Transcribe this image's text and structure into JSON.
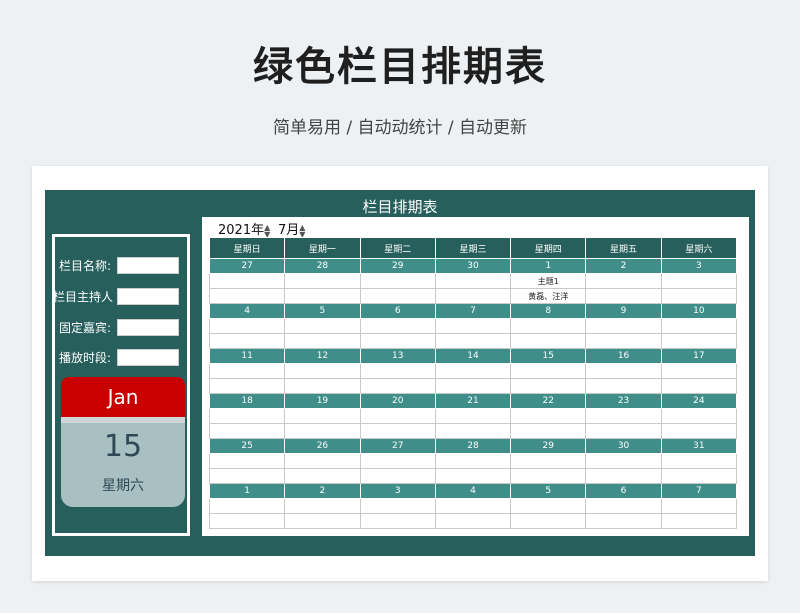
{
  "page": {
    "title": "绿色栏目排期表",
    "subtitle": "简单易用 / 自动动统计 / 自动更新"
  },
  "sheet": {
    "title": "栏目排期表",
    "year_value": "2021年",
    "month_value": "7月",
    "fields": [
      {
        "label": "栏目名称:",
        "value": ""
      },
      {
        "label": "栏目主持人",
        "value": ""
      },
      {
        "label": "固定嘉宾:",
        "value": ""
      },
      {
        "label": "播放时段:",
        "value": ""
      }
    ],
    "calendar_card": {
      "month": "Jan",
      "day": "15",
      "weekday": "星期六"
    },
    "weekdays": [
      "星期日",
      "星期一",
      "星期二",
      "星期三",
      "星期四",
      "星期五",
      "星期六"
    ],
    "weeks": [
      {
        "dates": [
          "27",
          "28",
          "29",
          "30",
          "1",
          "2",
          "3"
        ],
        "events1": [
          "",
          "",
          "",
          "",
          "主题1",
          "",
          ""
        ],
        "events2": [
          "",
          "",
          "",
          "",
          "黄磊、汪洋",
          "",
          ""
        ]
      },
      {
        "dates": [
          "4",
          "5",
          "6",
          "7",
          "8",
          "9",
          "10"
        ],
        "events1": [
          "",
          "",
          "",
          "",
          "",
          "",
          ""
        ],
        "events2": [
          "",
          "",
          "",
          "",
          "",
          "",
          ""
        ]
      },
      {
        "dates": [
          "11",
          "12",
          "13",
          "14",
          "15",
          "16",
          "17"
        ],
        "events1": [
          "",
          "",
          "",
          "",
          "",
          "",
          ""
        ],
        "events2": [
          "",
          "",
          "",
          "",
          "",
          "",
          ""
        ]
      },
      {
        "dates": [
          "18",
          "19",
          "20",
          "21",
          "22",
          "23",
          "24"
        ],
        "events1": [
          "",
          "",
          "",
          "",
          "",
          "",
          ""
        ],
        "events2": [
          "",
          "",
          "",
          "",
          "",
          "",
          ""
        ]
      },
      {
        "dates": [
          "25",
          "26",
          "27",
          "28",
          "29",
          "30",
          "31"
        ],
        "events1": [
          "",
          "",
          "",
          "",
          "",
          "",
          ""
        ],
        "events2": [
          "",
          "",
          "",
          "",
          "",
          "",
          ""
        ]
      },
      {
        "dates": [
          "1",
          "2",
          "3",
          "4",
          "5",
          "6",
          "7"
        ],
        "events1": [
          "",
          "",
          "",
          "",
          "",
          "",
          ""
        ],
        "events2": [
          "",
          "",
          "",
          "",
          "",
          "",
          ""
        ]
      }
    ],
    "colors": {
      "panel": "#265f5c",
      "date_row": "#3f8e8a",
      "calendar_red": "#c80000",
      "calendar_body": "#a9c0c2"
    }
  }
}
